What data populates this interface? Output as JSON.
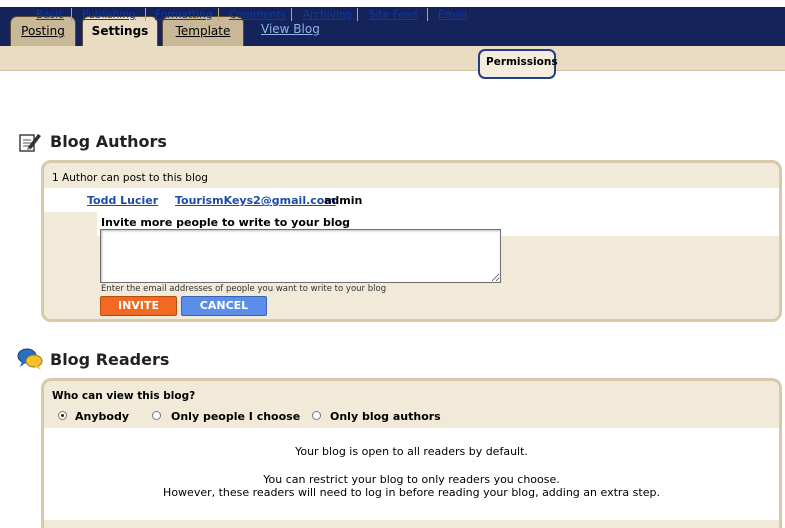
{
  "tabs": {
    "posting": "Posting",
    "settings": "Settings",
    "template": "Template",
    "view_blog": "View Blog"
  },
  "subnav": [
    "Basic",
    "Publishing",
    "Formatting",
    "Comments",
    "Archiving",
    "Site Feed",
    "Email",
    "Permissions"
  ],
  "authors": {
    "title": "Blog Authors",
    "count_text": "1 Author can post to this blog",
    "name": "Todd Lucier",
    "email": "TourismKeys2@gmail.com",
    "role": "admin",
    "invite_label": "Invite more people to write to your blog",
    "invite_value": "",
    "hint": "Enter the email addresses of people you want to write to your blog",
    "invite_button": "INVITE",
    "cancel_button": "CANCEL"
  },
  "readers": {
    "title": "Blog Readers",
    "question": "Who can view this blog?",
    "options": [
      "Anybody",
      "Only people I choose",
      "Only blog authors"
    ],
    "selected": "Anybody",
    "line1": "Your blog is open to all readers by default.",
    "line2": "You can restrict your blog to only readers you choose.",
    "line3": "However, these readers will need to log in before reading your blog, adding an extra step."
  },
  "colors": {
    "topbar": "#14235a",
    "tab_beige": "#e9dcc3",
    "invite_orange": "#f26a21",
    "cancel_blue": "#5a8ee8",
    "link_blue": "#1b4aa8"
  },
  "icons": {
    "authors": "edit-pencil-icon",
    "readers": "people-chat-icon"
  }
}
